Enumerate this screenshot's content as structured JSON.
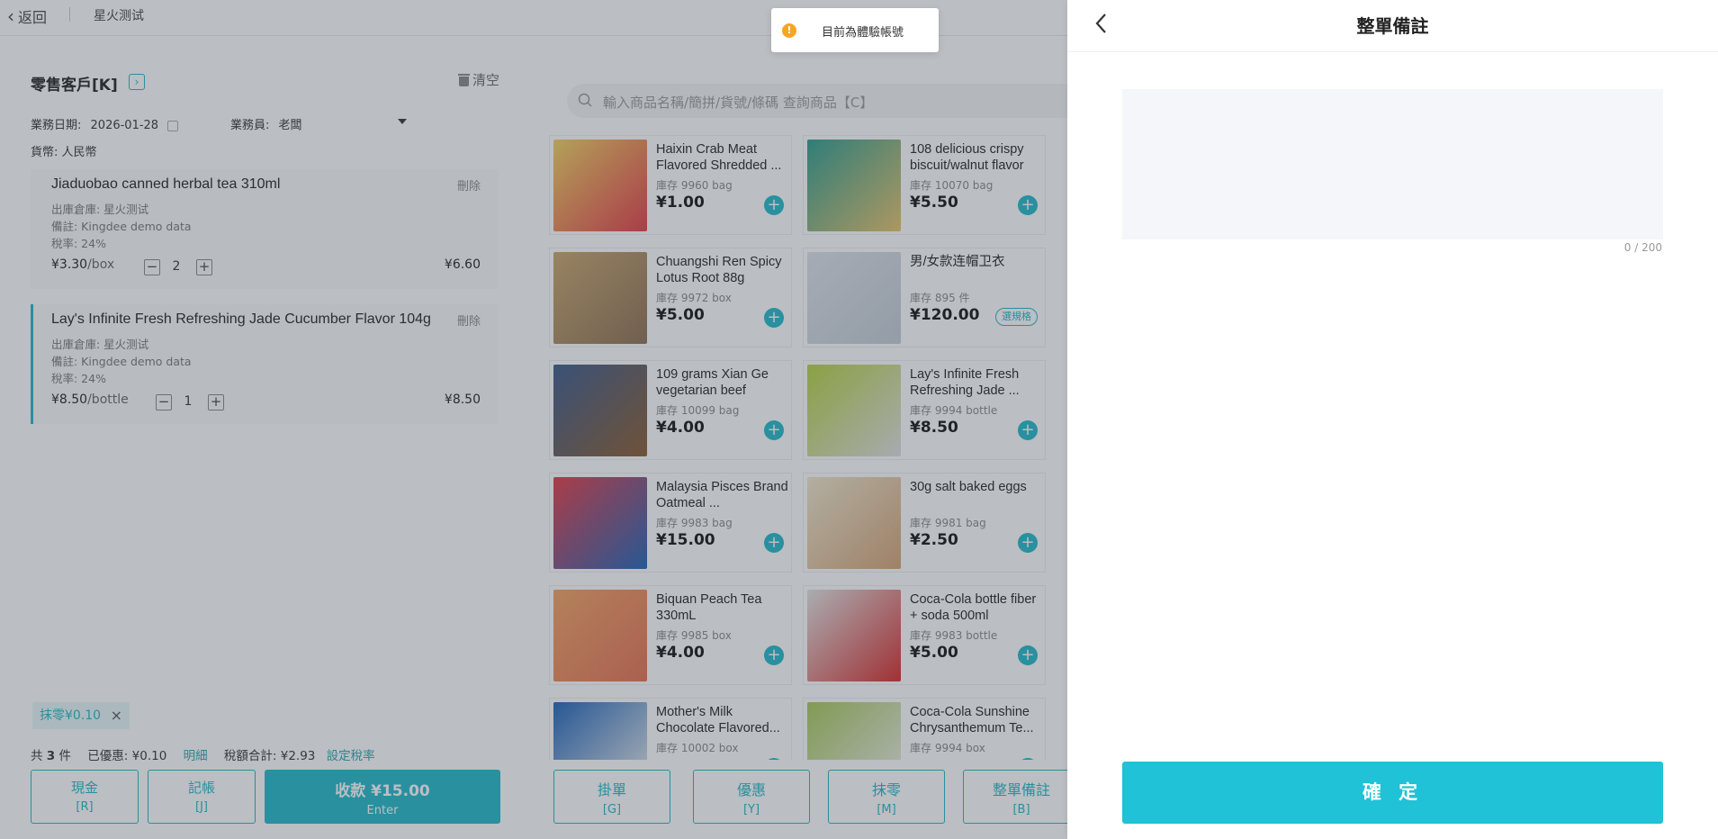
{
  "topbar": {
    "back_label": "返回",
    "org_name": "星火测试"
  },
  "order": {
    "customer": "零售客戶[K]",
    "clear_label": "清空",
    "date_label": "業務日期:",
    "date_value": "2026-01-28",
    "salesman_label": "業務員:",
    "salesman_value": "老闆",
    "currency_label": "貨幣:",
    "currency_value": "人民幣",
    "items": [
      {
        "name": "Jiaduobao canned herbal tea 310ml",
        "delete": "刪除",
        "warehouse": "出庫倉庫: 星火测试",
        "note": "備註: Kingdee demo data",
        "tax": "稅率: 24%",
        "price": "¥3.30",
        "unit": "/box",
        "qty": "2",
        "total": "¥6.60"
      },
      {
        "name": "Lay's Infinite Fresh Refreshing Jade Cucumber Flavor 104g",
        "delete": "刪除",
        "warehouse": "出庫倉庫: 星火测试",
        "note": "備註: Kingdee demo data",
        "tax": "稅率: 24%",
        "price": "¥8.50",
        "unit": "/bottle",
        "qty": "1",
        "total": "¥8.50"
      }
    ],
    "rounding_chip": "抹零¥0.10",
    "summary": {
      "count_prefix": "共",
      "count": "3",
      "count_suffix": "件",
      "discount": "已優惠: ¥0.10",
      "detail_link": "明細",
      "tax_total": "稅額合計: ¥2.93",
      "set_tax_link": "設定稅率"
    },
    "buttons": [
      {
        "label": "現金",
        "key": "[R]"
      },
      {
        "label": "記帳",
        "key": "[J]"
      },
      {
        "label": "收款 ¥15.00",
        "key": "Enter"
      }
    ]
  },
  "catalog": {
    "search_placeholder": "輸入商品名稱/簡拼/貨號/條碼 查詢商品【C】",
    "products": [
      {
        "name": "Haixin Crab Meat Flavored Shredded ...",
        "stock": "庫存 9960 bag",
        "price": "¥1.00",
        "action": "+"
      },
      {
        "name": "108 delicious crispy biscuit/walnut flavor",
        "stock": "庫存 10070 bag",
        "price": "¥5.50",
        "action": "+"
      },
      {
        "name": "Chuangshi Ren Spicy Lotus Root 88g",
        "stock": "庫存 9972 box",
        "price": "¥5.00",
        "action": "+"
      },
      {
        "name": "男/女款连帽卫衣",
        "stock": "庫存 895 件",
        "price": "¥120.00",
        "action": "選規格"
      },
      {
        "name": "109 grams Xian Ge vegetarian beef",
        "stock": "庫存 10099 bag",
        "price": "¥4.00",
        "action": "+"
      },
      {
        "name": "Lay's Infinite Fresh Refreshing Jade ...",
        "stock": "庫存 9994 bottle",
        "price": "¥8.50",
        "action": "+"
      },
      {
        "name": "Malaysia Pisces Brand Oatmeal ...",
        "stock": "庫存 9983 bag",
        "price": "¥15.00",
        "action": "+"
      },
      {
        "name": "30g salt baked eggs",
        "stock": "庫存 9981 bag",
        "price": "¥2.50",
        "action": "+"
      },
      {
        "name": "Biquan Peach Tea 330mL",
        "stock": "庫存 9985 box",
        "price": "¥4.00",
        "action": "+"
      },
      {
        "name": "Coca-Cola bottle fiber + soda 500ml",
        "stock": "庫存 9983 bottle",
        "price": "¥5.00",
        "action": "+"
      },
      {
        "name": "Mother's Milk Chocolate Flavored...",
        "stock": "庫存 10002 box",
        "price": "",
        "action": "+"
      },
      {
        "name": "Coca-Cola Sunshine Chrysanthemum Te...",
        "stock": "庫存 9994 box",
        "price": "",
        "action": "+"
      }
    ],
    "actions": [
      {
        "label": "掛單",
        "key": "[G]"
      },
      {
        "label": "優惠",
        "key": "[Y]"
      },
      {
        "label": "抹零",
        "key": "[M]"
      },
      {
        "label": "整單備註",
        "key": "[B]"
      }
    ]
  },
  "toast": {
    "text": "目前為體驗帳號"
  },
  "drawer": {
    "title": "整單備註",
    "note_value": "",
    "counter": "0 / 200",
    "confirm": "確 定"
  },
  "colors": {
    "accent": "#1fb8c9",
    "confirm": "#1fc2d6",
    "warning": "#f5a623"
  }
}
